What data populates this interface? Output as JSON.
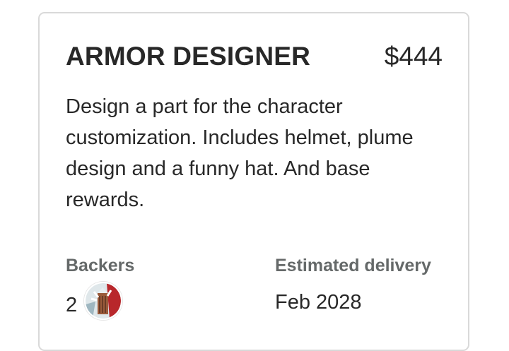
{
  "reward": {
    "title": "ARMOR DESIGNER",
    "price": "$444",
    "description": "Design a part for the character customization. Includes helmet, plume design and a funny hat. And base rewards."
  },
  "backers": {
    "label": "Backers",
    "count": "2"
  },
  "delivery": {
    "label": "Estimated delivery",
    "value": "Feb 2028"
  }
}
